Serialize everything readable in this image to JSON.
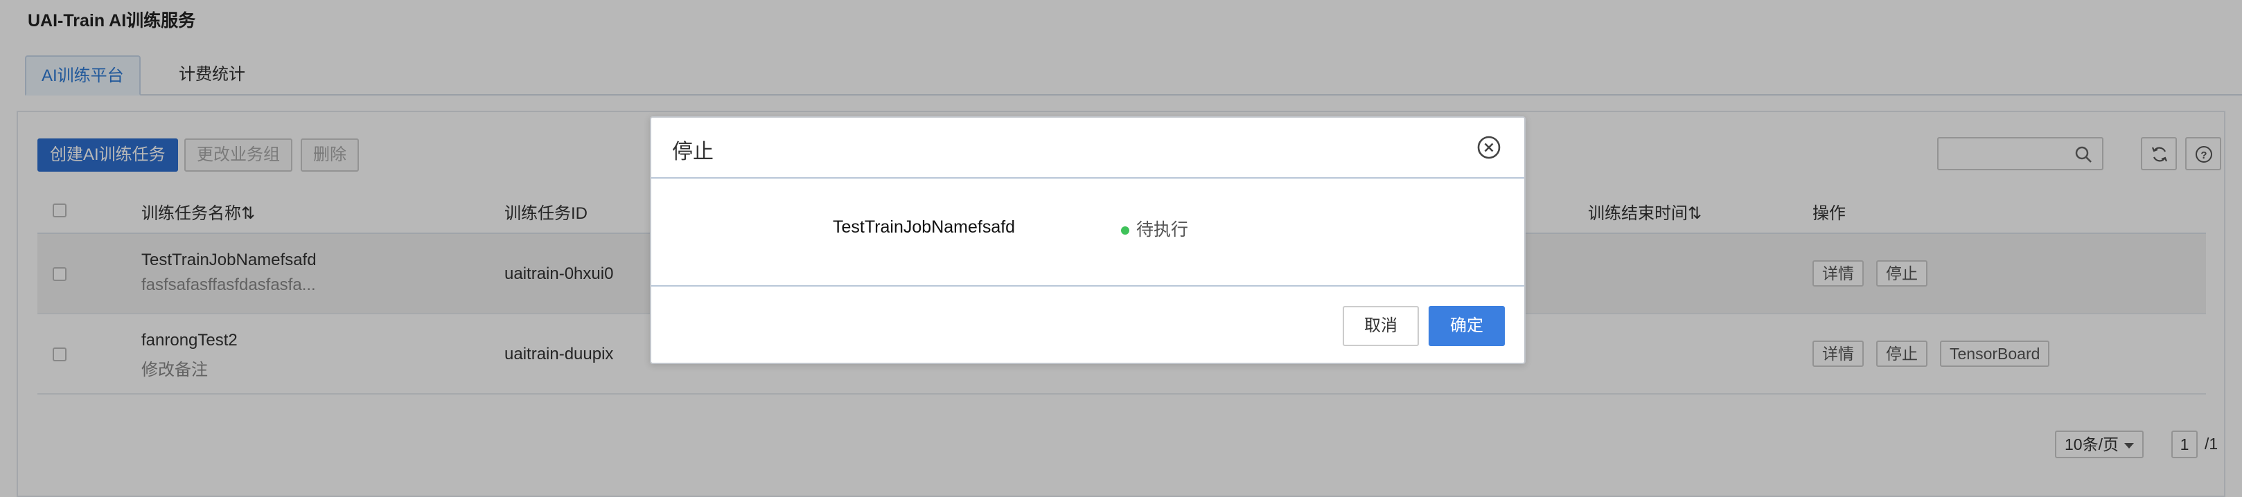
{
  "app": {
    "title": "UAI-Train AI训练服务"
  },
  "tabs": [
    {
      "label": "AI训练平台",
      "active": true
    },
    {
      "label": "计费统计",
      "active": false
    }
  ],
  "toolbar": {
    "create_label": "创建AI训练任务",
    "change_group_label": "更改业务组",
    "delete_label": "删除",
    "search_placeholder": ""
  },
  "table": {
    "headers": {
      "name": "训练任务名称⇅",
      "id": "训练任务ID",
      "end_time": "训练结束时间⇅",
      "ops": "操作"
    },
    "rows": [
      {
        "name": "TestTrainJobNamefsafd",
        "remark": "fasfsafasffasfdasfasfa...",
        "id": "uaitrain-0hxui0",
        "ops": [
          "详情",
          "停止"
        ]
      },
      {
        "name": "fanrongTest2",
        "remark": "修改备注",
        "id": "uaitrain-duupix",
        "ops": [
          "详情",
          "停止",
          "TensorBoard"
        ]
      }
    ]
  },
  "pager": {
    "page_size": "10条/页",
    "current_page": "1",
    "total": "/1"
  },
  "modal": {
    "title": "停止",
    "job_name": "TestTrainJobNamefsafd",
    "job_status": "待执行",
    "status_color": "#3fc25a",
    "cancel_label": "取消",
    "ok_label": "确定"
  },
  "colors": {
    "primary": "#2e6fd0",
    "confirm": "#3b7fe0",
    "tab_active": "#2d7ad6"
  }
}
